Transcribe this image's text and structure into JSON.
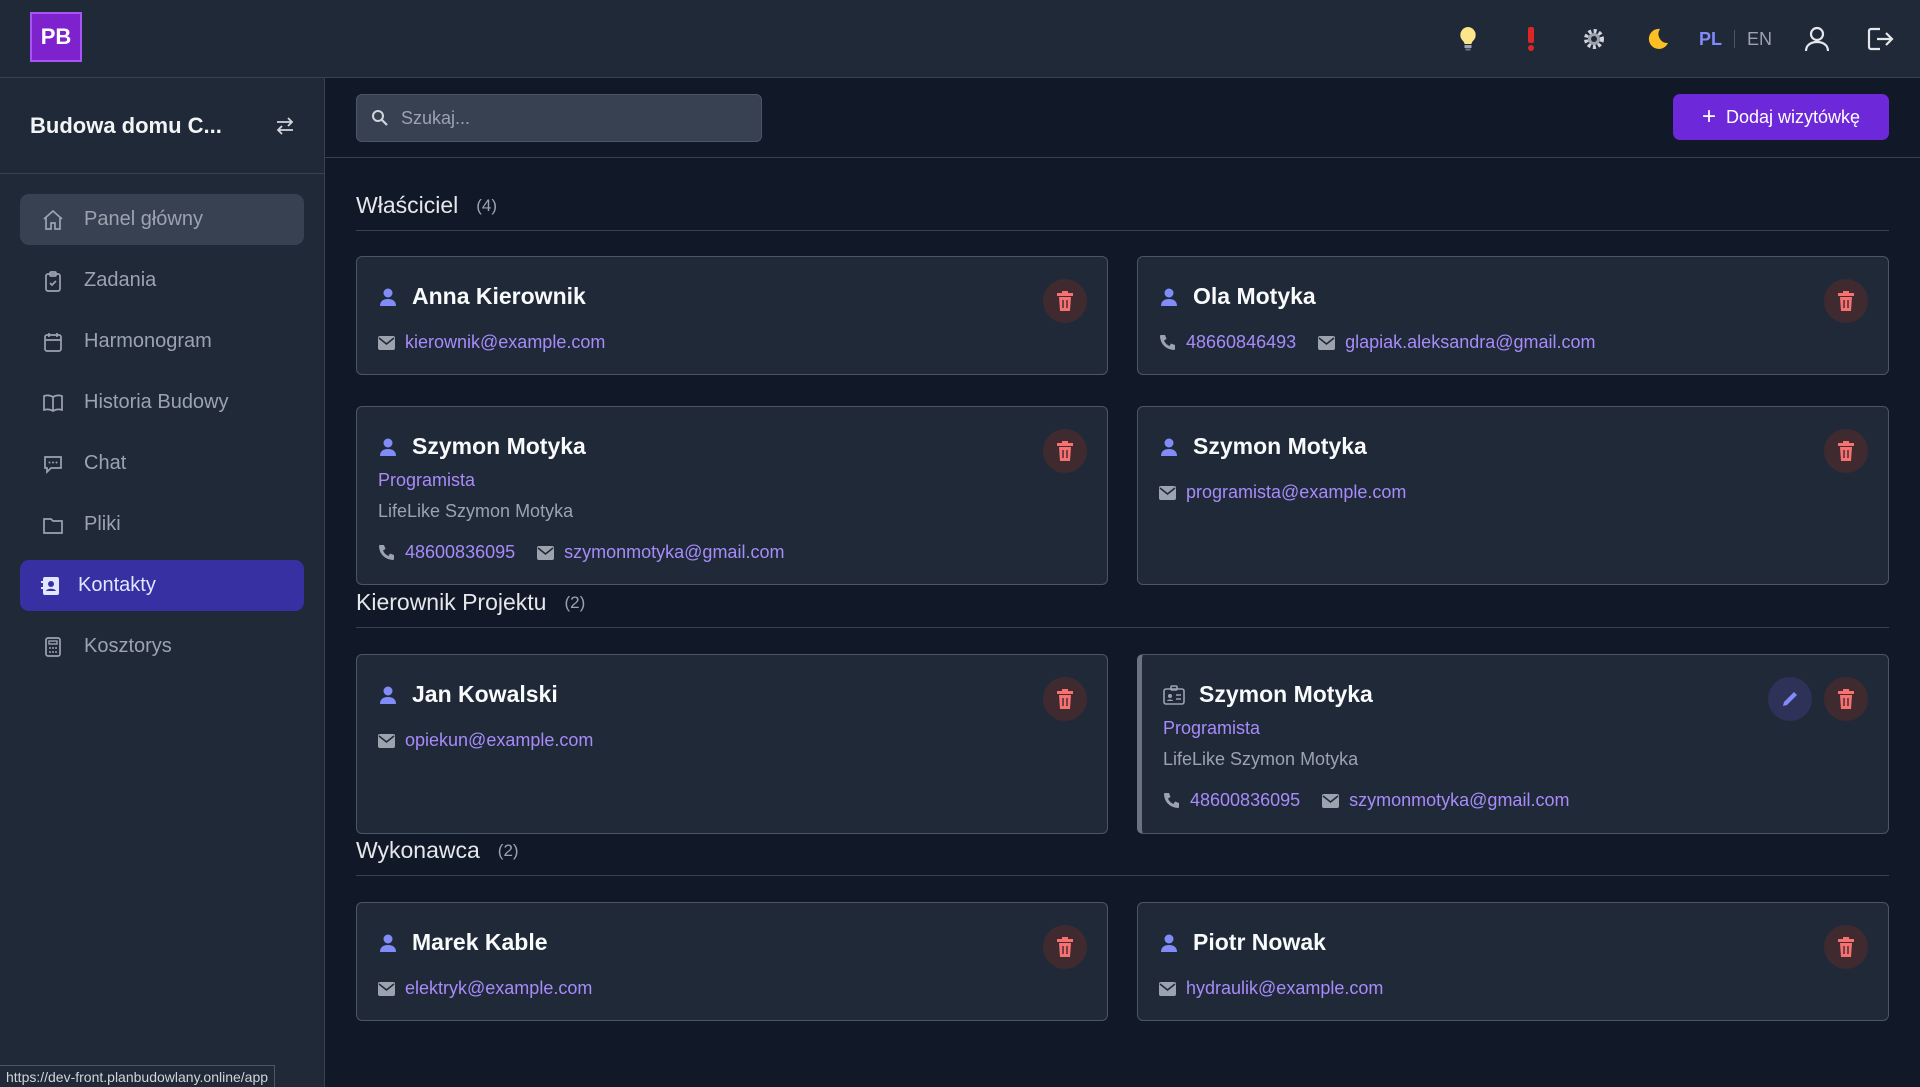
{
  "app": {
    "logo_text": "PB",
    "status_url": "https://dev-front.planbudowlany.online/app"
  },
  "topbar": {
    "icons": [
      "lightbulb-icon",
      "alert-icon",
      "gear-icon",
      "moon-icon"
    ],
    "lang_pl": "PL",
    "lang_en": "EN"
  },
  "sidebar": {
    "project_name": "Budowa domu C...",
    "items": [
      {
        "label": "Panel główny",
        "icon": "home-icon"
      },
      {
        "label": "Zadania",
        "icon": "clipboard-icon"
      },
      {
        "label": "Harmonogram",
        "icon": "calendar-icon"
      },
      {
        "label": "Historia Budowy",
        "icon": "book-icon"
      },
      {
        "label": "Chat",
        "icon": "chat-icon"
      },
      {
        "label": "Pliki",
        "icon": "folder-icon"
      },
      {
        "label": "Kontakty",
        "icon": "contacts-icon"
      },
      {
        "label": "Kosztorys",
        "icon": "calculator-icon"
      }
    ]
  },
  "toolbar": {
    "search_placeholder": "Szukaj...",
    "add_label": "Dodaj wizytówkę"
  },
  "sections": [
    {
      "name": "Właściciel",
      "count": "(4)",
      "cards": [
        {
          "name": "Anna Kierownik",
          "email": "kierownik@example.com"
        },
        {
          "name": "Ola Motyka",
          "phone": "48660846493",
          "email": "glapiak.aleksandra@gmail.com"
        },
        {
          "name": "Szymon Motyka",
          "role": "Programista",
          "company": "LifeLike Szymon Motyka",
          "phone": "48600836095",
          "email": "szymonmotyka@gmail.com"
        },
        {
          "name": "Szymon Motyka",
          "email": "programista@example.com"
        }
      ]
    },
    {
      "name": "Kierownik Projektu",
      "count": "(2)",
      "cards": [
        {
          "name": "Jan Kowalski",
          "email": "opiekun@example.com"
        },
        {
          "name": "Szymon Motyka",
          "role": "Programista",
          "company": "LifeLike Szymon Motyka",
          "phone": "48600836095",
          "email": "szymonmotyka@gmail.com"
        }
      ]
    },
    {
      "name": "Wykonawca",
      "count": "(2)",
      "cards": [
        {
          "name": "Marek Kable",
          "email": "elektryk@example.com"
        },
        {
          "name": "Piotr Nowak",
          "email": "hydraulik@example.com"
        }
      ]
    }
  ],
  "colors": {
    "accent": "#6d28d9",
    "link": "#a78bfa",
    "delete": "#f87171",
    "background": "#111827",
    "panel": "#1f2937"
  }
}
